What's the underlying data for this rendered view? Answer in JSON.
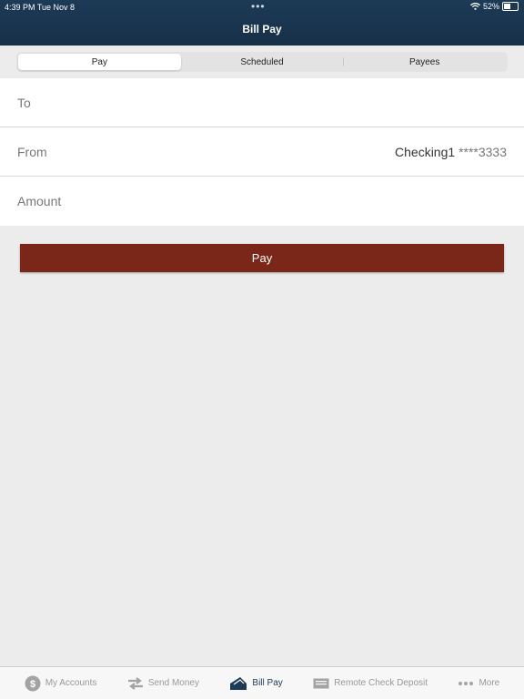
{
  "status": {
    "time": "4:39 PM   Tue Nov 8",
    "battery": "52%",
    "battery_level": 0.52
  },
  "header": {
    "title": "Bill Pay"
  },
  "segments": [
    {
      "label": "Pay",
      "active": true
    },
    {
      "label": "Scheduled",
      "active": false
    },
    {
      "label": "Payees",
      "active": false
    }
  ],
  "form": {
    "to_label": "To",
    "from_label": "From",
    "from_account": "Checking1",
    "from_mask": "****3333",
    "amount_label": "Amount"
  },
  "pay_button": "Pay",
  "tabs": [
    {
      "label": "My Accounts",
      "icon": "dollar-icon"
    },
    {
      "label": "Send Money",
      "icon": "transfer-icon"
    },
    {
      "label": "Bill Pay",
      "icon": "bill-pay-icon",
      "active": true
    },
    {
      "label": "Remote Check Deposit",
      "icon": "check-icon"
    },
    {
      "label": "More",
      "icon": "more-icon"
    }
  ],
  "colors": {
    "header": "#1d3a56",
    "accent_button": "#7a2719",
    "background": "#ececec"
  }
}
